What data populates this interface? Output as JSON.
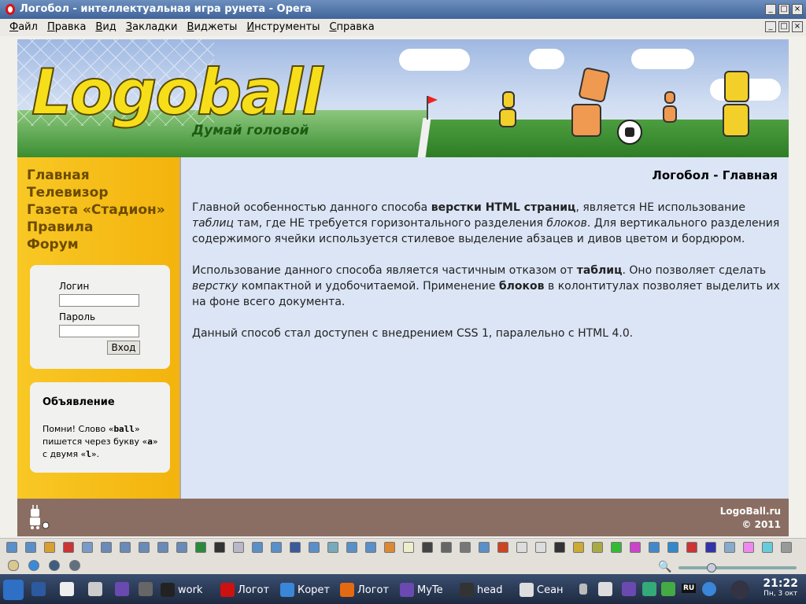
{
  "window": {
    "title": "Логобол - интеллектуальная игра рунета - Opera",
    "buttons": [
      "_",
      "□",
      "×"
    ]
  },
  "menu": {
    "items": [
      "Файл",
      "Правка",
      "Вид",
      "Закладки",
      "Виджеты",
      "Инструменты",
      "Справка"
    ]
  },
  "site": {
    "logo_text": "Logoball",
    "slogan": "Думай головой",
    "nav": [
      "Главная",
      "Телевизор",
      "Газета «Стадион»",
      "Правила",
      "Форум"
    ],
    "login": {
      "login_label": "Логин",
      "password_label": "Пароль",
      "button": "Вход"
    },
    "ad": {
      "title": "Объявление",
      "text_before": "Помни! Слово «",
      "word": "ball",
      "text_mid1": "» пишется через букву «",
      "letter_a": "a",
      "text_mid2": "» с двумя «",
      "letter_l": "l",
      "text_after": "»."
    },
    "main": {
      "title": "Логобол - Главная",
      "p1": [
        {
          "t": "Главной особенностью данного способа ",
          "s": ""
        },
        {
          "t": "верстки HTML страниц",
          "s": "b"
        },
        {
          "t": ", является НЕ использование ",
          "s": ""
        },
        {
          "t": "таблиц",
          "s": "i"
        },
        {
          "t": " там, где НЕ требуется горизонтального разделения ",
          "s": ""
        },
        {
          "t": "блоков",
          "s": "i"
        },
        {
          "t": ". Для вертикального разделения содержимого ячейки используется стилевое выделение абзацев и дивов цветом и бордюром.",
          "s": ""
        }
      ],
      "p2": [
        {
          "t": "Использование данного способа является частичным отказом от ",
          "s": ""
        },
        {
          "t": "таблиц",
          "s": "b"
        },
        {
          "t": ". Оно позволяет сделать ",
          "s": ""
        },
        {
          "t": "верстку",
          "s": "i"
        },
        {
          "t": " компактной и удобочитаемой. Применение ",
          "s": ""
        },
        {
          "t": "блоков",
          "s": "b"
        },
        {
          "t": " в колонтитулах позволяет выделить их на фоне всего документа.",
          "s": ""
        }
      ],
      "p3": [
        {
          "t": "Данный способ стал доступен с внедрением CSS 1, паралельно с HTML 4.0.",
          "s": ""
        }
      ]
    },
    "footer": {
      "site": "LogoBall.ru",
      "copyright": "© 2011"
    }
  },
  "taskbar": {
    "tasks": [
      {
        "label": "work",
        "icon": "terminal-icon",
        "color": "#222222"
      },
      {
        "label": "Логот",
        "icon": "opera-icon",
        "color": "#cc1111"
      },
      {
        "label": "Корет",
        "icon": "kopete-icon",
        "color": "#3a86d8"
      },
      {
        "label": "Логот",
        "icon": "firefox-icon",
        "color": "#e46a12"
      },
      {
        "label": "MyTe",
        "icon": "mytetra-icon",
        "color": "#6a4ab0"
      },
      {
        "label": "head",
        "icon": "inkscape-icon",
        "color": "#333333"
      },
      {
        "label": "Сеан",
        "icon": "editor-icon",
        "color": "#dddddd"
      }
    ],
    "lang": "RU",
    "time": "21:22",
    "date": "Пн, 3 окт"
  },
  "colors": {
    "sidebar": "#f6bd1a",
    "nav_text": "#6b4b00",
    "main_bg": "#dbe5f5",
    "footer_bg": "#8a6e63"
  }
}
